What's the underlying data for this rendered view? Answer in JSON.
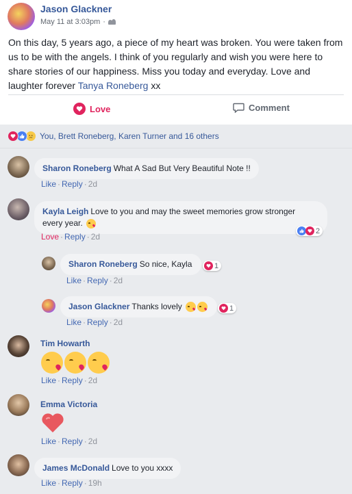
{
  "post": {
    "author": "Jason Glackner",
    "date": "May 11 at 3:03pm",
    "audience_icon": "friends-icon",
    "text_before_tag": "On this day, 5 years ago, a piece of my heart was broken. You were taken from us to be with the angels. I think of you regularly and wish you were here to share stories of our happiness. Miss you today and everyday. Love and laughter forever ",
    "tagged_name": "Tanya Roneberg",
    "text_after_tag": " xx",
    "love_label": "Love",
    "comment_label": "Comment"
  },
  "reactions_summary": "You, Brett Roneberg, Karen Turner and 16 others",
  "comments": [
    {
      "name": "Sharon Roneberg",
      "text": "What A Sad But Very Beautiful Note !!",
      "like": "Like",
      "reply": "Reply",
      "time": "2d"
    },
    {
      "name": "Kayla Leigh",
      "text": "Love to you and may the sweet memories grow stronger every year.",
      "like": "Love",
      "reply": "Reply",
      "time": "2d",
      "reaction_count": "2"
    },
    {
      "name": "Sharon Roneberg",
      "text": "So nice, Kayla",
      "like": "Like",
      "reply": "Reply",
      "time": "2d",
      "reaction_count": "1"
    },
    {
      "name": "Jason Glackner",
      "text": "Thanks lovely",
      "like": "Like",
      "reply": "Reply",
      "time": "2d",
      "reaction_count": "1"
    },
    {
      "name": "Tim Howarth",
      "like": "Like",
      "reply": "Reply",
      "time": "2d"
    },
    {
      "name": "Emma Victoria",
      "like": "Like",
      "reply": "Reply",
      "time": "2d"
    },
    {
      "name": "James McDonald",
      "text": "Love to you xxxx",
      "like": "Like",
      "reply": "Reply",
      "time": "19h"
    }
  ],
  "colors": {
    "link": "#365899",
    "love": "#e0245e",
    "like": "#4267b2",
    "bubble": "#f2f3f5"
  }
}
